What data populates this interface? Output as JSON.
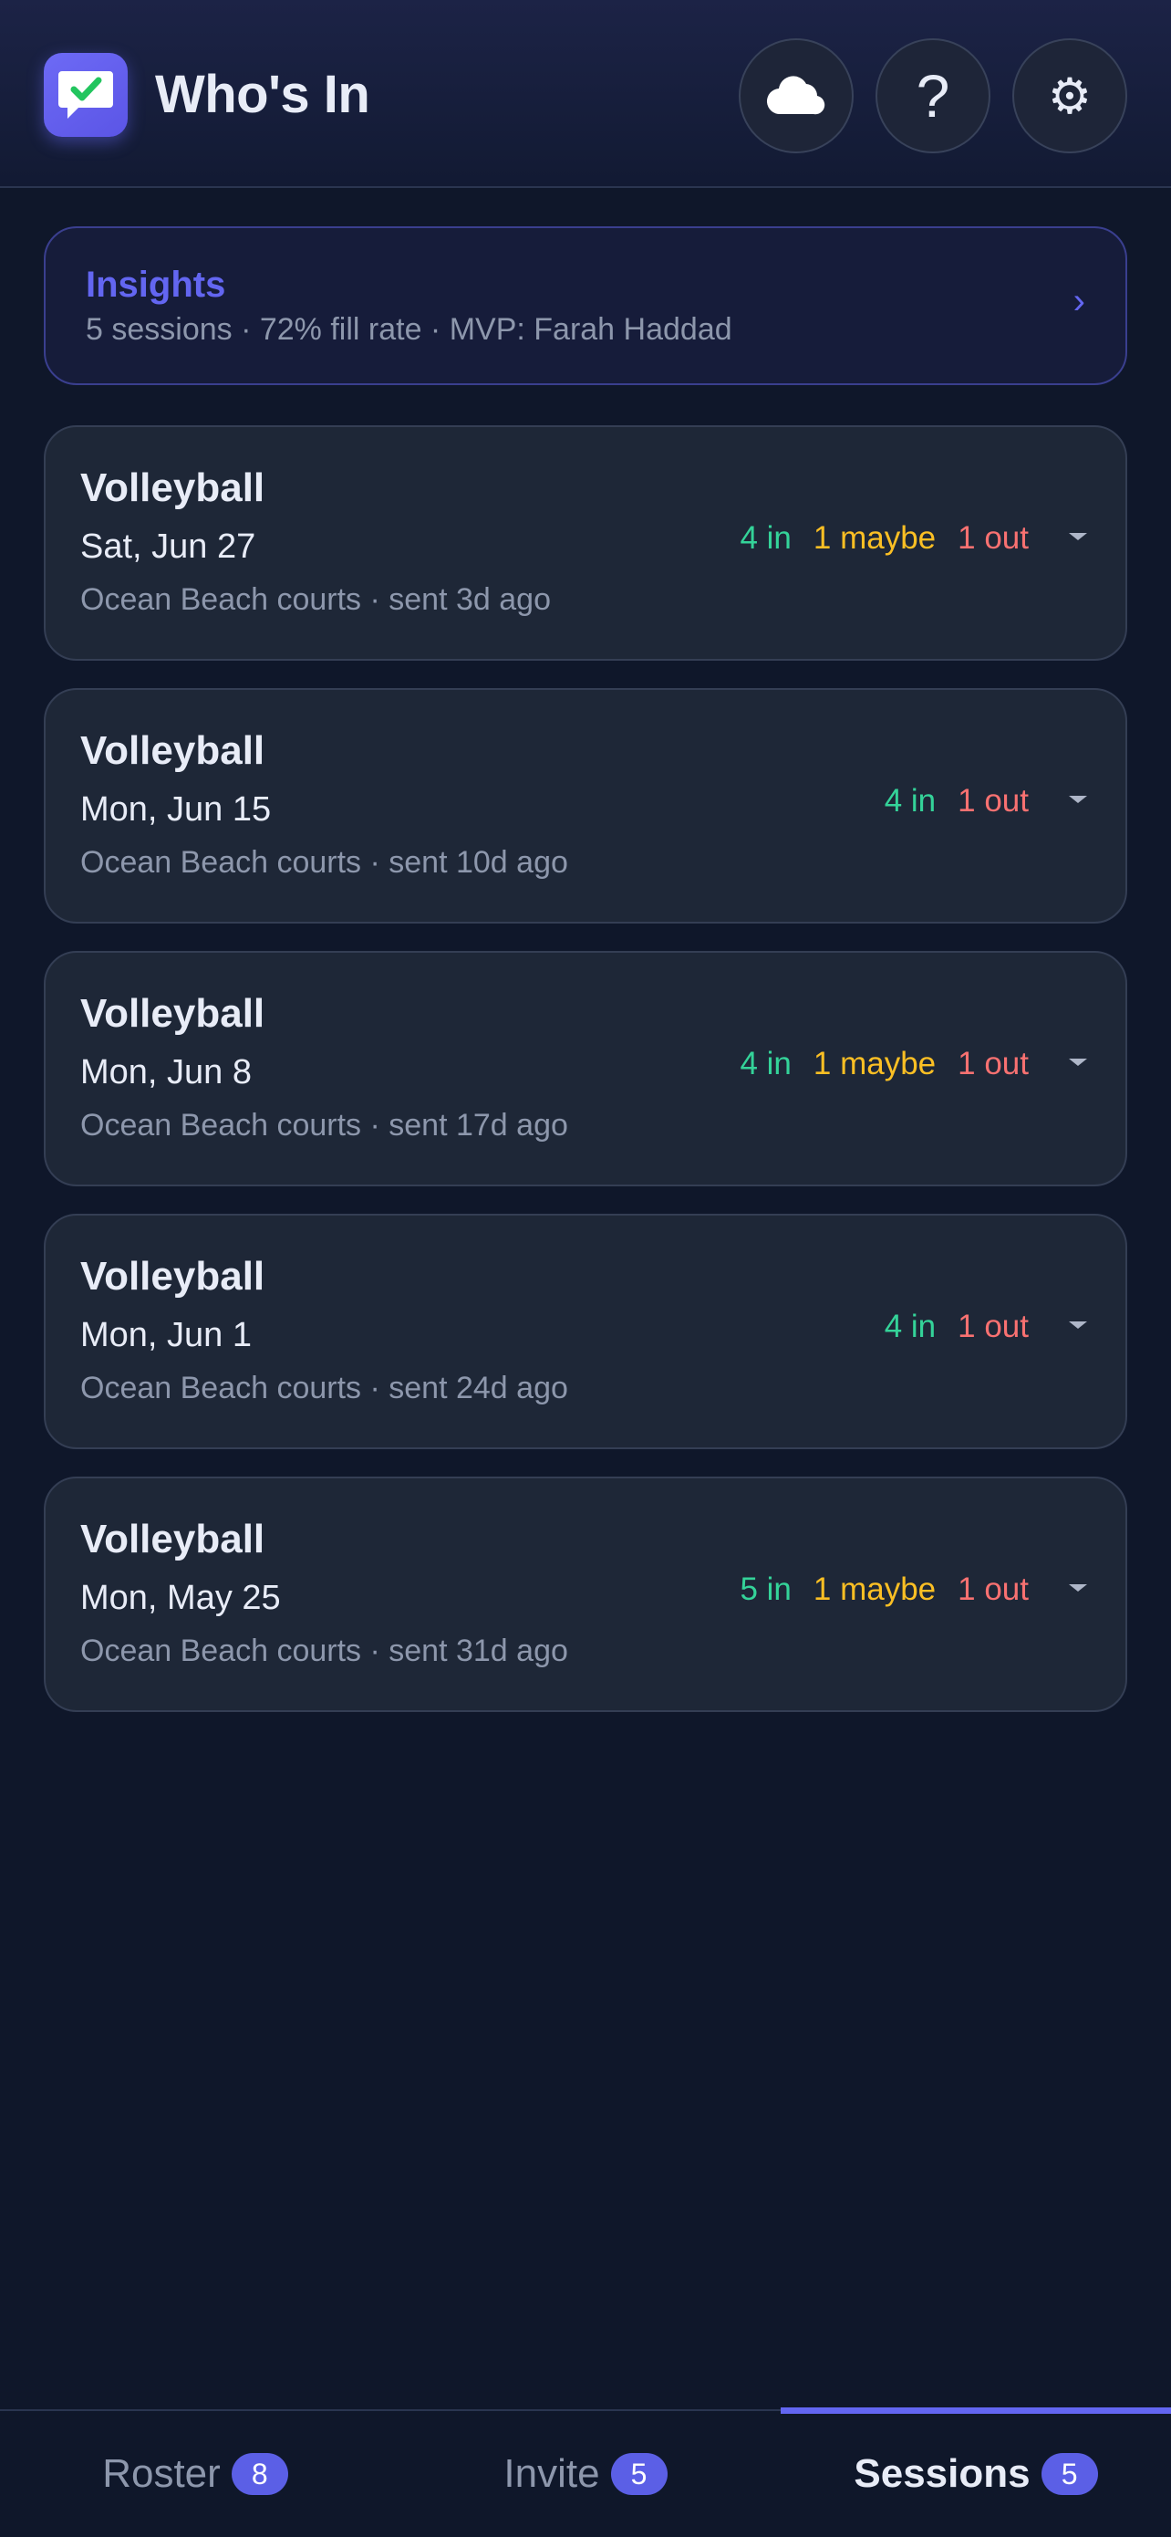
{
  "header": {
    "title": "Who's In",
    "icons": [
      "chat-check-icon",
      "cloud-icon",
      "help-icon",
      "gear-icon"
    ],
    "help_label": "?",
    "gear_glyph": "⚙"
  },
  "insights": {
    "title": "Insights",
    "summary": "5 sessions · 72% fill rate · MVP: Farah Haddad",
    "chevron": "›"
  },
  "sessions": [
    {
      "sport": "Volleyball",
      "date": "Sat, Jun 27",
      "meta": "Ocean Beach courts · sent 3d ago",
      "in": "4 in",
      "maybe": "1 maybe",
      "out": "1 out"
    },
    {
      "sport": "Volleyball",
      "date": "Mon, Jun 15",
      "meta": "Ocean Beach courts · sent 10d ago",
      "in": "4 in",
      "maybe": "",
      "out": "1 out"
    },
    {
      "sport": "Volleyball",
      "date": "Mon, Jun 8",
      "meta": "Ocean Beach courts · sent 17d ago",
      "in": "4 in",
      "maybe": "1 maybe",
      "out": "1 out"
    },
    {
      "sport": "Volleyball",
      "date": "Mon, Jun 1",
      "meta": "Ocean Beach courts · sent 24d ago",
      "in": "4 in",
      "maybe": "",
      "out": "1 out"
    },
    {
      "sport": "Volleyball",
      "date": "Mon, May 25",
      "meta": "Ocean Beach courts · sent 31d ago",
      "in": "5 in",
      "maybe": "1 maybe",
      "out": "1 out"
    }
  ],
  "tabs": [
    {
      "label": "Roster",
      "count": "8",
      "active": false
    },
    {
      "label": "Invite",
      "count": "5",
      "active": false
    },
    {
      "label": "Sessions",
      "count": "5",
      "active": true
    }
  ],
  "colors": {
    "accent": "#6366f1",
    "in": "#34d399",
    "maybe": "#fbbf24",
    "out": "#f87171",
    "background": "#0f172a",
    "card": "#1e2737"
  }
}
